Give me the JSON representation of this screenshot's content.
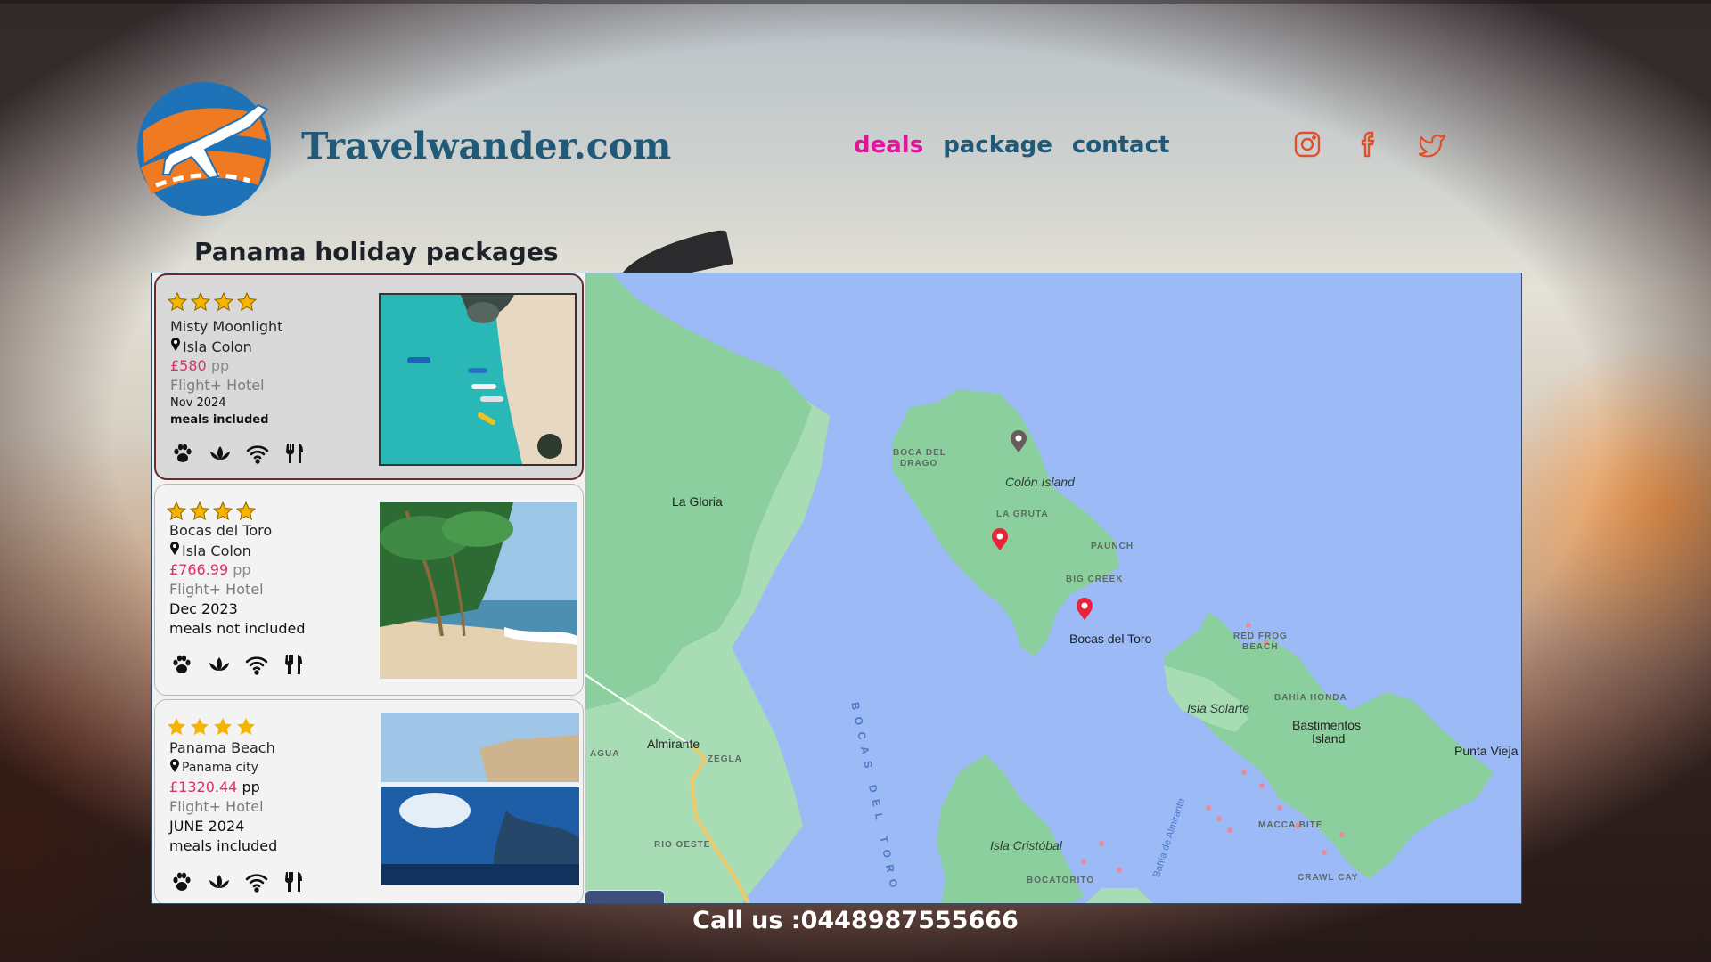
{
  "header": {
    "brand": "Travelwander.com",
    "nav": [
      {
        "label": "deals",
        "active": true
      },
      {
        "label": "package",
        "active": false
      },
      {
        "label": "contact",
        "active": false
      }
    ],
    "social_icons": [
      "instagram-icon",
      "facebook-icon",
      "twitter-icon"
    ]
  },
  "page": {
    "title": "Panama holiday packages"
  },
  "cards": [
    {
      "stars": 4,
      "name": "Misty Moonlight",
      "location": "Isla Colon",
      "price": "£580",
      "per": "pp",
      "type": "Flight+ Hotel",
      "date": "Nov 2024",
      "meals": "meals included",
      "amenities": [
        "paw-icon",
        "lotus-icon",
        "wifi-icon",
        "restaurant-icon"
      ],
      "photo": "aerial beach with boats"
    },
    {
      "stars": 4,
      "name": "Bocas del Toro",
      "location": "Isla Colon",
      "price": "£766.99",
      "per": "pp",
      "type": "Flight+ Hotel",
      "date": "Dec 2023",
      "meals": "meals not included",
      "amenities": [
        "paw-icon",
        "lotus-icon",
        "wifi-icon",
        "restaurant-icon"
      ],
      "photo": "palm tree beach"
    },
    {
      "stars": 4,
      "name": "Panama Beach",
      "location": "Panama city",
      "price": "£1320.44",
      "per": "pp",
      "type": "Flight+ Hotel",
      "date": "JUNE 2024",
      "meals": "meals included",
      "amenities": [
        "paw-icon",
        "lotus-icon",
        "wifi-icon",
        "restaurant-icon"
      ],
      "photo": "underwater split view"
    }
  ],
  "map": {
    "labels": {
      "la_gloria": "La Gloria",
      "boca_del": "BOCA DEL",
      "drago": "DRAGO",
      "colon_island": "Colón Island",
      "la_gruta": "LA GRUTA",
      "paunch": "PAUNCH",
      "big_creek": "BIG CREEK",
      "bocas_del_toro": "Bocas del Toro",
      "red_frog": "RED FROG",
      "beach": "BEACH",
      "bahia_honda": "BAHÍA HONDA",
      "isla_solarte": "Isla Solarte",
      "bastimentos": "Bastimentos",
      "island": "Island",
      "punta_vieja": "Punta Vieja",
      "almirante": "Almirante",
      "agua": "AGUA",
      "zegla": "ZEGLA",
      "rio_oeste": "RIO OESTE",
      "bocas_water": "BOCAS DEL TORO",
      "isla_cristobal": "Isla Cristóbal",
      "bocatorito": "BOCATORITO",
      "macca_bite": "MACCA BITE",
      "crawl_cay": "CRAWL CAY",
      "bahia_almirante": "Bahía de Almirante"
    },
    "pins": [
      {
        "color": "#6b5a5a"
      },
      {
        "color": "#e8243a"
      },
      {
        "color": "#e8243a"
      }
    ]
  },
  "footer": {
    "text": "Call us :0448987555666"
  },
  "colors": {
    "brand": "#215a78",
    "nav_active": "#e0169a",
    "price": "#d8316f",
    "social": "#e0502a",
    "star": "#f5b400"
  }
}
